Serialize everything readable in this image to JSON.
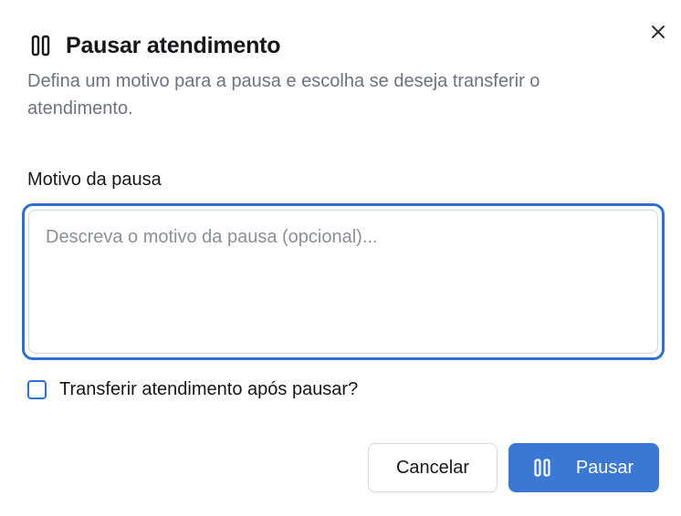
{
  "dialog": {
    "title": "Pausar atendimento",
    "subtitle": "Defina um motivo para a pausa e escolha se deseja transferir o atendimento.",
    "title_icon": "pause-icon",
    "close_icon": "close-icon"
  },
  "reason": {
    "label": "Motivo da pausa",
    "placeholder": "Descreva o motivo da pausa (opcional)...",
    "value": ""
  },
  "transfer": {
    "label": "Transferir atendimento após pausar?",
    "checked": false
  },
  "actions": {
    "cancel_label": "Cancelar",
    "pause_label": "Pausar",
    "pause_icon": "pause-icon"
  },
  "colors": {
    "accent": "#3b78d4",
    "focus_ring": "#2f6fd0",
    "text": "#15171a",
    "muted": "#6b7280"
  }
}
